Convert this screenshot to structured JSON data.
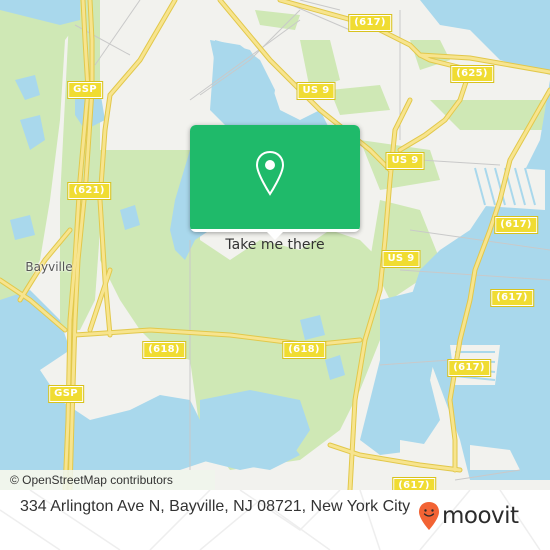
{
  "map": {
    "colors": {
      "land": "#f2f2ee",
      "water": "#a9d8ec",
      "forest": "#cfe8b5",
      "road_major": "#f5e07a",
      "road_major_casing": "#e2c84a",
      "road_minor": "#c8c8c8"
    },
    "road_labels": [
      {
        "id": "gsp-north",
        "text": "GSP"
      },
      {
        "id": "gsp-south",
        "text": "GSP"
      },
      {
        "id": "cr-621",
        "text": "(621)"
      },
      {
        "id": "cr-617-top",
        "text": "(617)"
      },
      {
        "id": "cr-625",
        "text": "(625)"
      },
      {
        "id": "us9-a",
        "text": "US 9"
      },
      {
        "id": "us9-b",
        "text": "US 9"
      },
      {
        "id": "us9-c",
        "text": "US 9"
      },
      {
        "id": "cr-617-east-a",
        "text": "(617)"
      },
      {
        "id": "cr-617-east-b",
        "text": "(617)"
      },
      {
        "id": "cr-617-east-c",
        "text": "(617)"
      },
      {
        "id": "cr-617-bottom",
        "text": "(617)"
      },
      {
        "id": "cr-618-west",
        "text": "(618)"
      },
      {
        "id": "cr-618-east",
        "text": "(618)"
      }
    ],
    "place_labels": [
      {
        "id": "bayville",
        "text": "Bayville"
      }
    ],
    "attribution": "© OpenStreetMap contributors"
  },
  "popup": {
    "icon": "map-pin-icon",
    "accent": "#1fba6a",
    "button_label": "Take me there"
  },
  "footer": {
    "address": "334 Arlington Ave N, Bayville, NJ 08721, New York City",
    "brand": "moovit",
    "brand_icon": "moovit-smiley-pin-icon",
    "brand_color": "#f26334"
  }
}
